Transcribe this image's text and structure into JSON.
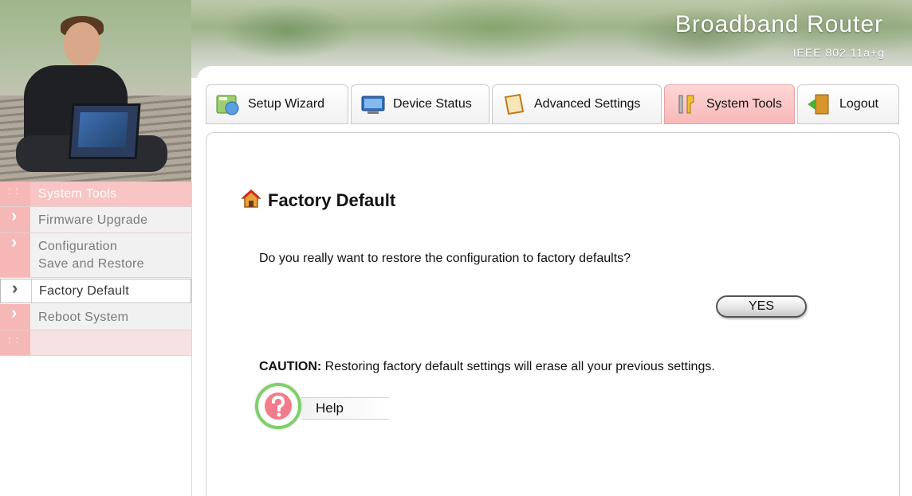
{
  "header": {
    "brand": "Broadband Router",
    "standard": "IEEE 802.11a+g"
  },
  "tabs": [
    {
      "label": "Setup Wizard",
      "icon": "setup-wizard-icon"
    },
    {
      "label": "Device Status",
      "icon": "device-status-icon"
    },
    {
      "label": "Advanced Settings",
      "icon": "advanced-settings-icon"
    },
    {
      "label": "System Tools",
      "icon": "system-tools-icon",
      "active": true
    },
    {
      "label": "Logout",
      "icon": "logout-icon"
    }
  ],
  "sidebar": {
    "heading": "System Tools",
    "items": [
      {
        "label": "Firmware Upgrade"
      },
      {
        "label_line1": "Configuration",
        "label_line2": "Save and Restore"
      },
      {
        "label": "Factory Default",
        "active": true
      },
      {
        "label": "Reboot System"
      }
    ]
  },
  "main": {
    "title": "Factory Default",
    "question": "Do you really want to restore the configuration to factory defaults?",
    "yes_label": "YES",
    "caution_label": "CAUTION:",
    "caution_text": " Restoring factory default settings will erase all your previous settings.",
    "help_label": "Help"
  },
  "colors": {
    "accent_pink": "#f8c4c4",
    "active_tab": "#f7b8b8",
    "help_ring": "#7ed06a"
  }
}
